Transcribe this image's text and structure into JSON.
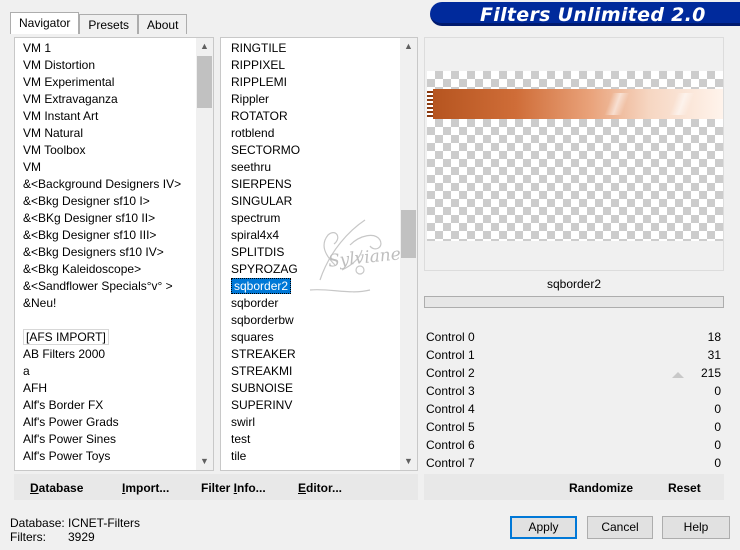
{
  "title": "Filters Unlimited 2.0",
  "tabs": [
    "Navigator",
    "Presets",
    "About"
  ],
  "categories": [
    "VM 1",
    "VM Distortion",
    "VM Experimental",
    "VM Extravaganza",
    "VM Instant Art",
    "VM Natural",
    "VM Toolbox",
    "VM",
    "&<Background Designers IV>",
    "&<Bkg Designer sf10 I>",
    "&<BKg Designer sf10 II>",
    "&<Bkg Designer sf10 III>",
    "&<Bkg Designers sf10 IV>",
    "&<Bkg Kaleidoscope>",
    "&<Sandflower Specials°v° >",
    "&Neu!",
    "",
    "[AFS IMPORT]",
    "AB Filters 2000",
    "a",
    "AFH",
    "Alf's Border FX",
    "Alf's Power Grads",
    "Alf's Power Sines",
    "Alf's Power Toys"
  ],
  "filters": [
    "RINGTILE",
    "RIPPIXEL",
    "RIPPLEMI",
    "Rippler",
    "ROTATOR",
    "rotblend",
    "SECTORMO",
    "seethru",
    "SIERPENS",
    "SINGULAR",
    "spectrum",
    "spiral4x4",
    "SPLITDIS",
    "SPYROZAG",
    "sqborder2",
    "sqborder",
    "sqborderbw",
    "squares",
    "STREAKER",
    "STREAKMI",
    "SUBNOISE",
    "SUPERINV",
    "swirl",
    "test",
    "tile"
  ],
  "selected_filter": "sqborder2",
  "watermark": "Sylviane",
  "filter_name": "sqborder2",
  "controls": [
    {
      "label": "Control 0",
      "value": "18"
    },
    {
      "label": "Control 1",
      "value": "31"
    },
    {
      "label": "Control 2",
      "value": "215"
    },
    {
      "label": "Control 3",
      "value": "0"
    },
    {
      "label": "Control 4",
      "value": "0"
    },
    {
      "label": "Control 5",
      "value": "0"
    },
    {
      "label": "Control 6",
      "value": "0"
    },
    {
      "label": "Control 7",
      "value": "0"
    }
  ],
  "buttons": {
    "database": {
      "u": "D",
      "rest": "atabase"
    },
    "import": {
      "u": "I",
      "rest": "mport..."
    },
    "filter_info": {
      "pre": "Filter ",
      "u": "I",
      "rest": "nfo..."
    },
    "editor": {
      "u": "E",
      "rest": "ditor..."
    },
    "randomize": "Randomize",
    "reset": "Reset",
    "apply": "Apply",
    "cancel": "Cancel",
    "help": "Help"
  },
  "status": {
    "database_label": "Database:",
    "database_value": "ICNET-Filters",
    "filters_label": "Filters:",
    "filters_value": "3929"
  },
  "colors": {
    "accent": "#0078d7",
    "banner": "#002a9c",
    "border_gradient": "#c4622a"
  }
}
